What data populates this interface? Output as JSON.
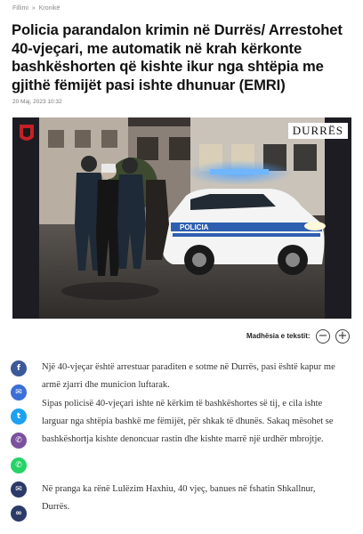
{
  "breadcrumb": {
    "home": "Fillimi",
    "sep": "»",
    "section": "Kronikë"
  },
  "article": {
    "title": "Policia parandalon krimin në Durrës/ Arrestohet 40-vjeçari, me automatik në krah kërkonte bashkëshorten që kishte ikur nga shtëpia me gjithë fëmijët pasi ishte dhunuar (EMRI)",
    "date": "20 Maj, 2023 10:32",
    "photo": {
      "place_label": "DURRËS",
      "car_label": "POLICIA"
    },
    "font_size_label": "Madhësia e tekstit:",
    "font_minus": "−",
    "font_plus": "+",
    "paragraphs": [
      "Një 40-vjeçar është arrestuar paraditen e sotme në Durrës, pasi është kapur me armë zjarri dhe municion luftarak.",
      "Sipas policisë 40-vjeçari ishte në kërkim të bashkëshortes së tij, e cila ishte larguar nga shtëpia bashkë me fëmijët, për shkak të dhunës. Sakaq mësohet se bashkëshortja kishte denoncuar rastin dhe kishte marrë një urdhër mbrojtje.",
      "Në pranga ka rënë Lulëzim Haxhiu, 40 vjeç, banues në fshatin Shkallnur, Durrës."
    ]
  },
  "share": [
    {
      "name": "facebook-icon",
      "color": "#3b5998",
      "glyph": "f"
    },
    {
      "name": "messenger-icon",
      "color": "#3b6fd8",
      "glyph": "✉"
    },
    {
      "name": "twitter-icon",
      "color": "#1da1f2",
      "glyph": "t"
    },
    {
      "name": "viber-icon",
      "color": "#7b519d",
      "glyph": "✆"
    },
    {
      "name": "whatsapp-icon",
      "color": "#25d366",
      "glyph": "✆"
    },
    {
      "name": "email-icon",
      "color": "#2b3a67",
      "glyph": "✉"
    },
    {
      "name": "link-icon",
      "color": "#2b3a67",
      "glyph": "∞"
    }
  ]
}
